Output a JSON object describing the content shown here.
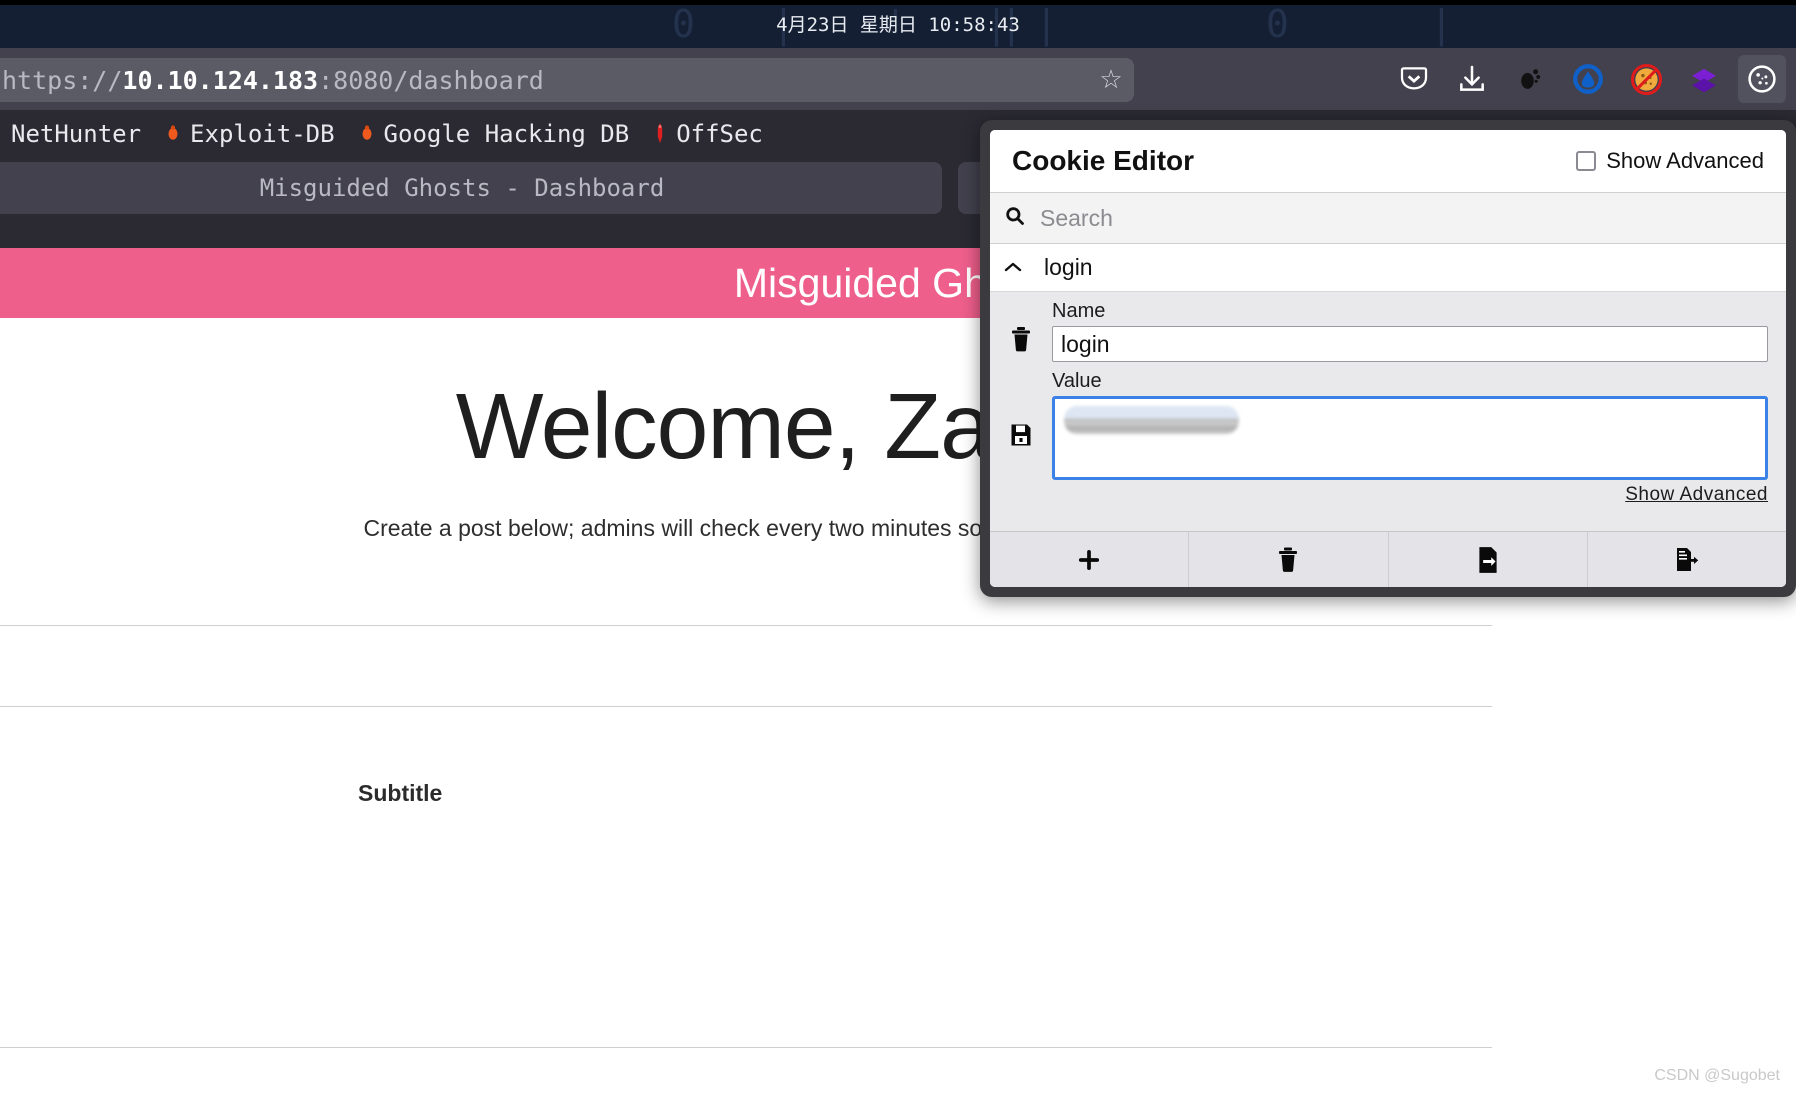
{
  "desktop": {
    "clock": "4月23日 星期日 10:58:43",
    "ghost_chars": [
      "0",
      "|",
      "'",
      "|",
      "|",
      "|",
      "0",
      "|"
    ]
  },
  "browser": {
    "url_full": "https://10.10.124.183:8080/dashboard",
    "url_prefix": "https://",
    "url_host": "10.10.124.183",
    "url_suffix": ":8080/dashboard",
    "bookmark_star_icon": "star-icon",
    "tab_title": "Misguided Ghosts - Dashboard",
    "bookmarks": [
      {
        "label": "NetHunter",
        "icon": ""
      },
      {
        "label": "Exploit-DB",
        "icon": "🐞"
      },
      {
        "label": "Google Hacking DB",
        "icon": "🐞"
      },
      {
        "label": "OffSec",
        "icon": "🌡"
      }
    ],
    "toolbar_icons": [
      {
        "name": "pocket-icon"
      },
      {
        "name": "download-icon"
      },
      {
        "name": "gnome-foot-icon"
      },
      {
        "name": "blue-circle-extension-icon"
      },
      {
        "name": "no-cookie-extension-icon"
      },
      {
        "name": "purple-layers-extension-icon"
      },
      {
        "name": "cookie-editor-extension-icon"
      }
    ]
  },
  "page": {
    "banner_title": "Misguided Ghosts",
    "banner_color": "#ef5f8c",
    "welcome_heading": "Welcome, Zac",
    "welcome_subtext": "Create a post below; admins will check every two minutes so don't be rude.",
    "subtitle_label": "Subtitle",
    "watermark": "CSDN @Sugobet"
  },
  "cookie_editor": {
    "title": "Cookie Editor",
    "show_advanced_checkbox_label": "Show Advanced",
    "search_placeholder": "Search",
    "cookie_entry_name": "login",
    "name_field_label": "Name",
    "name_field_value": "login",
    "value_field_label": "Value",
    "value_field_value": "n",
    "show_advanced_link": "Show Advanced",
    "focus_color": "#3b82e8",
    "actions": [
      {
        "name": "add-cookie-button",
        "icon": "plus-icon"
      },
      {
        "name": "delete-all-cookies-button",
        "icon": "trash-icon"
      },
      {
        "name": "import-cookies-button",
        "icon": "import-icon"
      },
      {
        "name": "export-cookies-button",
        "icon": "export-icon"
      }
    ],
    "side_icons": [
      {
        "name": "delete-cookie-icon"
      },
      {
        "name": "save-cookie-icon"
      }
    ]
  }
}
